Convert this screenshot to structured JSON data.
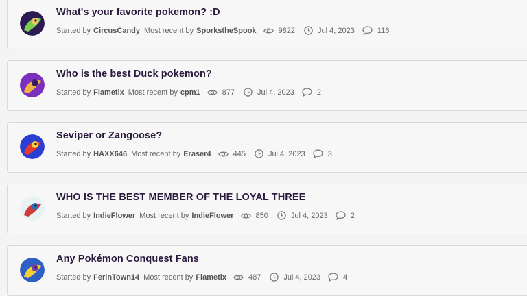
{
  "labels": {
    "started_by": "Started by",
    "most_recent_by": "Most recent by"
  },
  "threads": [
    {
      "title": "What's your favorite pokemon? :D",
      "starter": "CircusCandy",
      "recent": "SporkstheSpook",
      "views": "9822",
      "date": "Jul 4, 2023",
      "comments": "116",
      "avatar_colors": [
        "#2b1b52",
        "#7bd14e",
        "#e9c66a"
      ]
    },
    {
      "title": "Who is the best Duck pokemon?",
      "starter": "Flametix",
      "recent": "cpm1",
      "views": "877",
      "date": "Jul 4, 2023",
      "comments": "2",
      "avatar_colors": [
        "#7a2fbf",
        "#f0b33a",
        "#3b1c6a"
      ]
    },
    {
      "title": "Seviper or Zangoose?",
      "starter": "HAXX646",
      "recent": "Eraser4",
      "views": "445",
      "date": "Jul 4, 2023",
      "comments": "3",
      "avatar_colors": [
        "#2a3fd1",
        "#e83a2a",
        "#f4d23c"
      ]
    },
    {
      "title": "WHO IS THE BEST MEMBER OF THE LOYAL THREE",
      "starter": "IndieFlower",
      "recent": "IndieFlower",
      "views": "850",
      "date": "Jul 4, 2023",
      "comments": "2",
      "avatar_colors": [
        "#e8f2f5",
        "#d23a3a",
        "#2a6fb6"
      ]
    },
    {
      "title": "Any Pokémon Conquest Fans",
      "starter": "FerinTown14",
      "recent": "Flametix",
      "views": "487",
      "date": "Jul 4, 2023",
      "comments": "4",
      "avatar_colors": [
        "#2d5fc4",
        "#f2d030",
        "#7a3ea8"
      ]
    }
  ],
  "icons": {
    "views": "eye-icon",
    "date": "clock-icon",
    "comments": "comment-bubble-icon"
  }
}
